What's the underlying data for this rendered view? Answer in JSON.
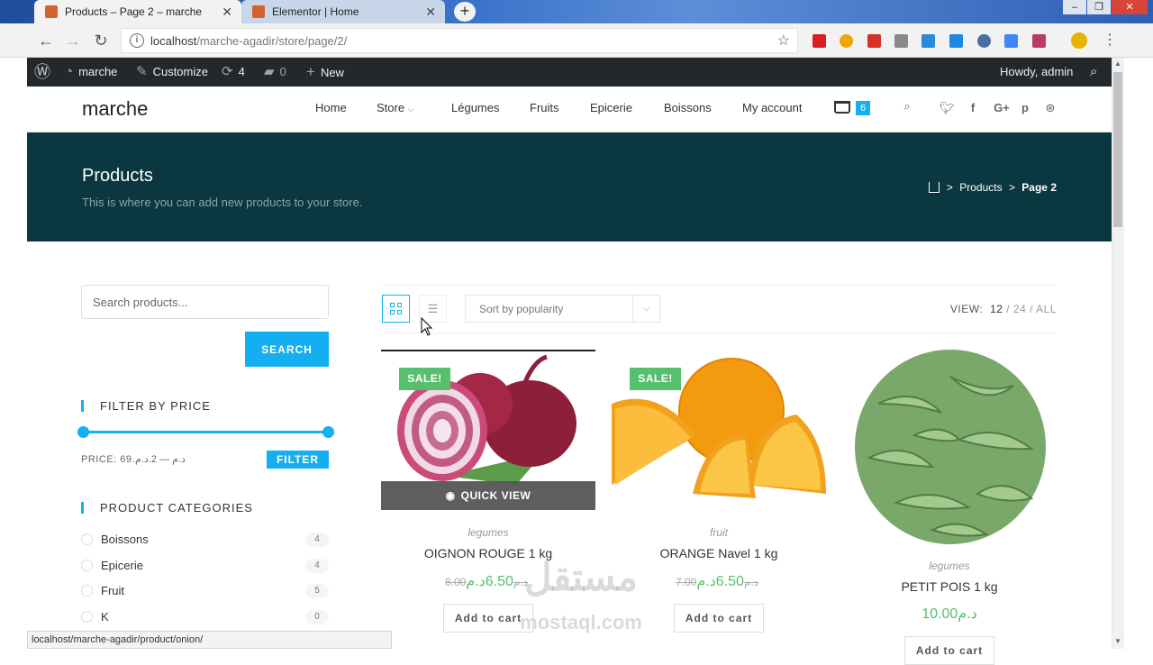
{
  "browser": {
    "tabs": [
      {
        "title": "Products – Page 2 – marche",
        "active": true
      },
      {
        "title": "Elementor | Home",
        "active": false
      }
    ],
    "new_tab": "+",
    "url_host": "localhost",
    "url_path": "/marche-agadir/store/page/2/",
    "status_url": "localhost/marche-agadir/product/onion/"
  },
  "admin_bar": {
    "site_name": "marche",
    "customize": "Customize",
    "updates_count": "4",
    "comments_count": "0",
    "new_label": "New",
    "howdy": "Howdy, admin"
  },
  "site": {
    "logo": "marche",
    "menu": [
      "Home",
      "Store",
      "Légumes",
      "Fruits",
      "Epicerie",
      "Boissons",
      "My account"
    ],
    "cart_count": "6"
  },
  "page_header": {
    "title": "Products",
    "subtitle": "This is where you can add new products to your store.",
    "breadcrumb_sep": ">",
    "breadcrumb_products": "Products",
    "breadcrumb_current": "Page 2"
  },
  "sidebar": {
    "search_placeholder": "Search products...",
    "search_button": "SEARCH",
    "filter_title": "FILTER BY PRICE",
    "price_label": "PRICE: 69.د.م — 2.د.م",
    "filter_button": "FILTER",
    "categories_title": "PRODUCT CATEGORIES",
    "categories": [
      {
        "name": "Boissons",
        "count": "4"
      },
      {
        "name": "Epicerie",
        "count": "4"
      },
      {
        "name": "Fruit",
        "count": "5"
      },
      {
        "name": "K",
        "count": "0"
      }
    ]
  },
  "toolbar": {
    "sort_label": "Sort by popularity",
    "view_label": "VIEW:",
    "view_options": [
      "12",
      "24",
      "ALL"
    ]
  },
  "products": [
    {
      "category": "legumes",
      "title": "OIGNON ROUGE 1 kg",
      "old_price": "8.00د.م",
      "price": "6.50د.م",
      "sale": "SALE!",
      "button": "Add to cart",
      "quick_view": "QUICK VIEW"
    },
    {
      "category": "fruit",
      "title": "ORANGE Navel 1 kg",
      "old_price": "7.00د.م",
      "price": "6.50د.م",
      "sale": "SALE!",
      "button": "Add to cart"
    },
    {
      "category": "legumes",
      "title": "PETIT POIS 1 kg",
      "price": "10.00د.م",
      "button": "Add to cart"
    }
  ],
  "watermark": {
    "arabic": "مستقل",
    "latin": "mostaql.com"
  },
  "colors": {
    "accent": "#13aff0",
    "header_band": "#0b3740",
    "sale": "#57bf6d",
    "admin_bar": "#23282d"
  }
}
